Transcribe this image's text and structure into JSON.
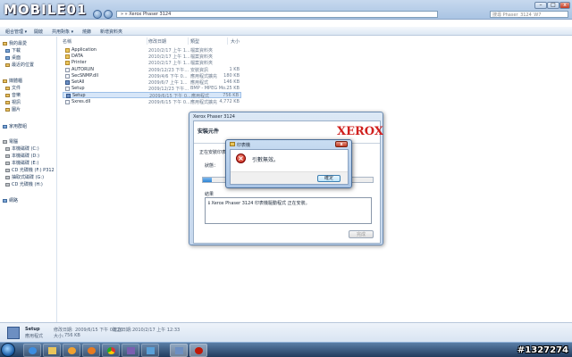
{
  "site_logo": "MOBILE01",
  "address_path": "» » Xerox Phaser 3124",
  "search_placeholder": "搜尋 Phaser_3124_W7",
  "toolbar": {
    "organize": "組合管理 ▾",
    "open": "開啟",
    "share": "共用對象 ▾",
    "burn": "燒錄",
    "new_folder": "新增資料夾"
  },
  "sidebar": {
    "favorites": "我的最愛",
    "downloads": "下載",
    "desktop": "桌面",
    "recent": "最近的位置",
    "libraries": "媒體櫃",
    "documents": "文件",
    "music": "音樂",
    "videos": "視訊",
    "pictures": "圖片",
    "homegroup": "家用群組",
    "computer": "電腦",
    "drive_c": "本機磁碟 (C:)",
    "drive_d": "本機磁碟 (D:)",
    "drive_e": "本機磁碟 (E:)",
    "drive_f": "CD 光碟機 (F:) P312",
    "drive_g": "抽取式磁碟 (G:)",
    "drive_h": "CD 光碟機 (H:)",
    "network": "網路"
  },
  "columns": {
    "name": "名稱",
    "date": "修改日期",
    "type": "類型",
    "size": "大小"
  },
  "files": [
    {
      "name": "Application",
      "date": "2010/2/17 上午 1...",
      "type": "檔案資料夾",
      "size": "",
      "kind": "folder"
    },
    {
      "name": "DATA",
      "date": "2010/2/17 上午 1...",
      "type": "檔案資料夾",
      "size": "",
      "kind": "folder"
    },
    {
      "name": "Printer",
      "date": "2010/2/17 上午 1...",
      "type": "檔案資料夾",
      "size": "",
      "kind": "folder"
    },
    {
      "name": "AUTORUN",
      "date": "2009/12/23 下午...",
      "type": "安裝資訊",
      "size": "1 KB",
      "kind": "file"
    },
    {
      "name": "SecSNMP.dll",
      "date": "2009/4/6 下午 0...",
      "type": "應用程式擴充",
      "size": "180 KB",
      "kind": "file"
    },
    {
      "name": "SetAll",
      "date": "2009/6/7 上午 1...",
      "type": "應用程式",
      "size": "146 KB",
      "kind": "exe"
    },
    {
      "name": "Setup",
      "date": "2009/12/23 下午...",
      "type": "BMP - MPEG Mo...",
      "size": "25 KB",
      "kind": "file"
    },
    {
      "name": "Setup",
      "date": "2009/6/15 下午 0...",
      "type": "應用程式",
      "size": "756 KB",
      "kind": "exe",
      "selected": true
    },
    {
      "name": "Sxres.dll",
      "date": "2009/6/15 下午 0...",
      "type": "應用程式擴充",
      "size": "4,772 KB",
      "kind": "file"
    }
  ],
  "installer": {
    "window_title": "Xerox Phaser 3124",
    "heading": "安裝元件",
    "brand": "XEROX",
    "status_line": "正在安裝印表機驅動程式...",
    "state_label": "狀態：",
    "progress": 0.05,
    "result_label": "結果",
    "result_text": "ℹ  Xerox Phaser 3124 印表機驅動程式 正在安裝。",
    "next_label": "完成"
  },
  "error_dialog": {
    "title": "印表機",
    "message": "引數無效。",
    "ok_label": "確定",
    "close_label": "x"
  },
  "details": {
    "name": "Setup",
    "type": "應用程式",
    "modified_label": "修改日期:",
    "modified": "2009/6/15 下午 08:26",
    "created_label": "建立日期:",
    "created": "2010/2/17 上午 12:33",
    "size_label": "大小:",
    "size": "756 KB"
  },
  "watermark": "#1327274"
}
